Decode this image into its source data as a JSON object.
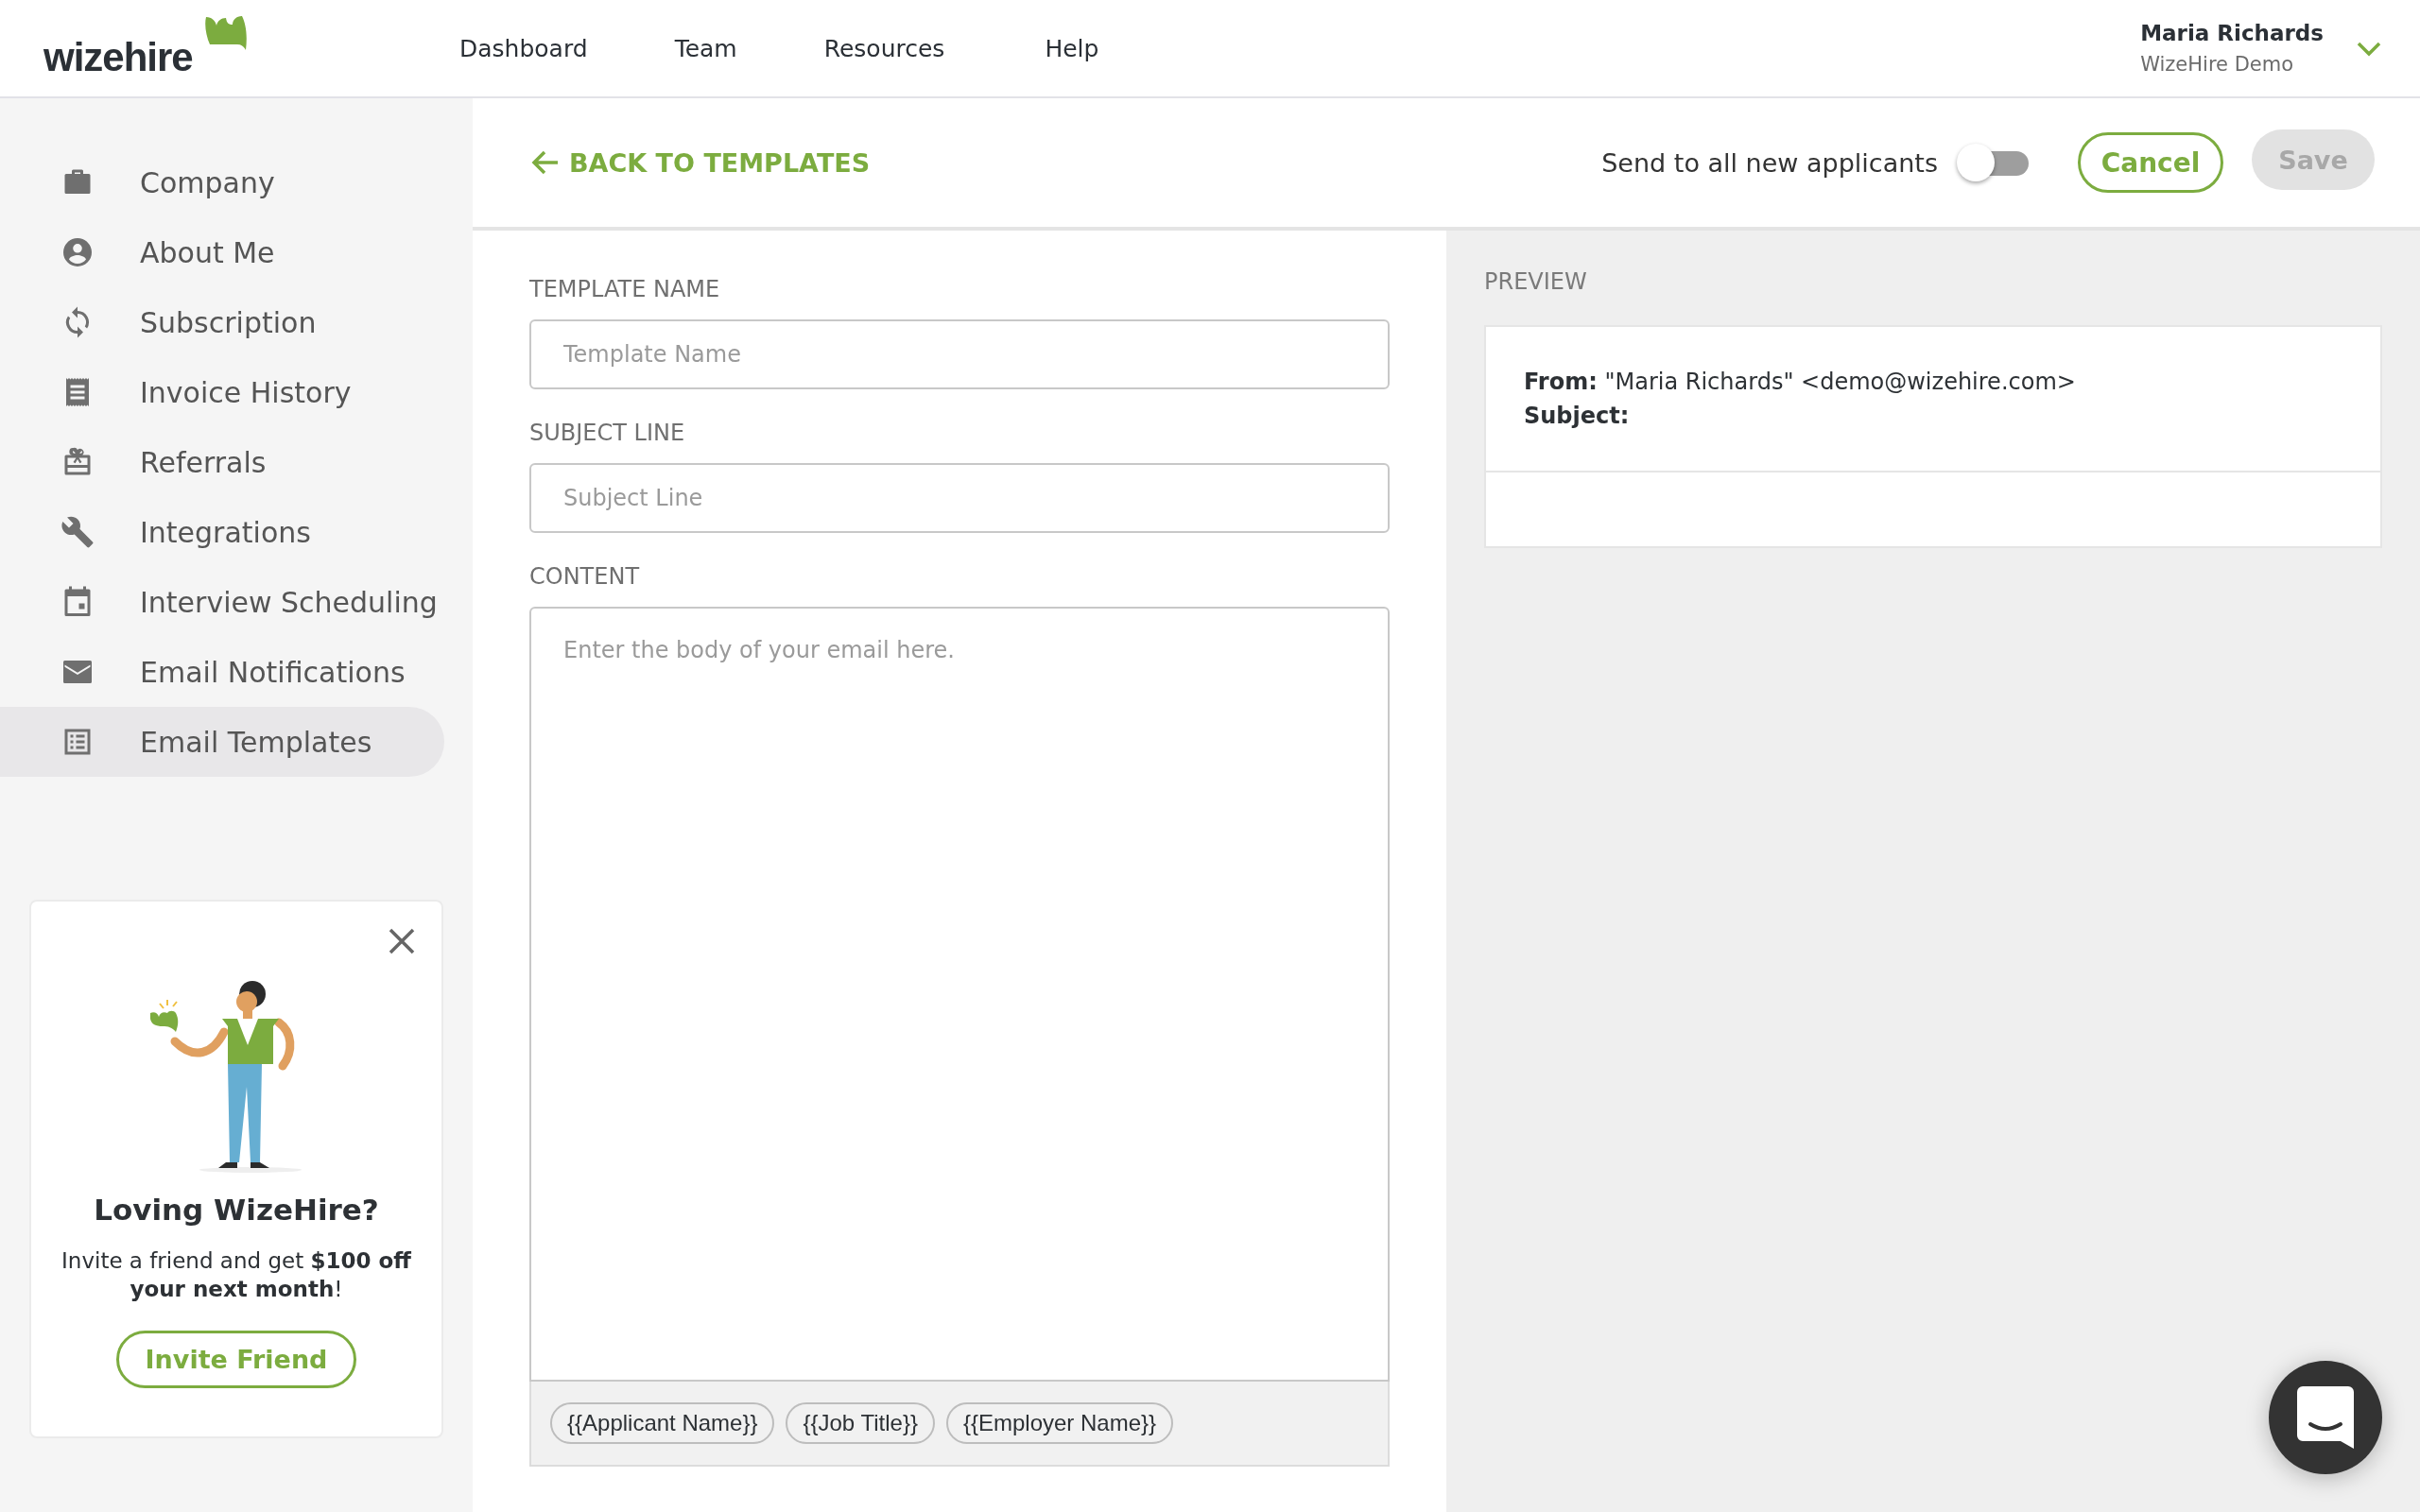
{
  "header": {
    "logo": "wizehire",
    "nav": [
      {
        "label": "Dashboard"
      },
      {
        "label": "Team"
      },
      {
        "label": "Resources"
      },
      {
        "label": "Help"
      }
    ],
    "user": {
      "name": "Maria Richards",
      "account": "WizeHire Demo"
    }
  },
  "sidebar": {
    "items": [
      {
        "label": "Company",
        "selected": false
      },
      {
        "label": "About Me",
        "selected": false
      },
      {
        "label": "Subscription",
        "selected": false
      },
      {
        "label": "Invoice History",
        "selected": false
      },
      {
        "label": "Referrals",
        "selected": false
      },
      {
        "label": "Integrations",
        "selected": false
      },
      {
        "label": "Interview Scheduling",
        "selected": false
      },
      {
        "label": "Email Notifications",
        "selected": false
      },
      {
        "label": "Email Templates",
        "selected": true
      }
    ],
    "promo": {
      "title": "Loving WizeHire?",
      "text": "Invite a friend and get **$100 off your next month**!",
      "button": "Invite Friend"
    }
  },
  "toolbar": {
    "back": "BACK TO TEMPLATES",
    "send_label": "Send to all new applicants",
    "send_on": false,
    "cancel": "Cancel",
    "save": "Save",
    "save_disabled": true
  },
  "form": {
    "fields": [
      {
        "label": "TEMPLATE NAME",
        "placeholder": "Template Name"
      },
      {
        "label": "SUBJECT LINE",
        "placeholder": "Subject Line"
      }
    ],
    "content": {
      "label": "CONTENT",
      "placeholder": "Enter the body of your email here."
    },
    "tokens": [
      "{{Applicant Name}}",
      "{{Job Title}}",
      "{{Employer Name}}"
    ]
  },
  "preview": {
    "title": "PREVIEW",
    "from_label": "From:",
    "from_value": "\"Maria Richards\" <demo@wizehire.com>",
    "subject_label": "Subject:"
  }
}
